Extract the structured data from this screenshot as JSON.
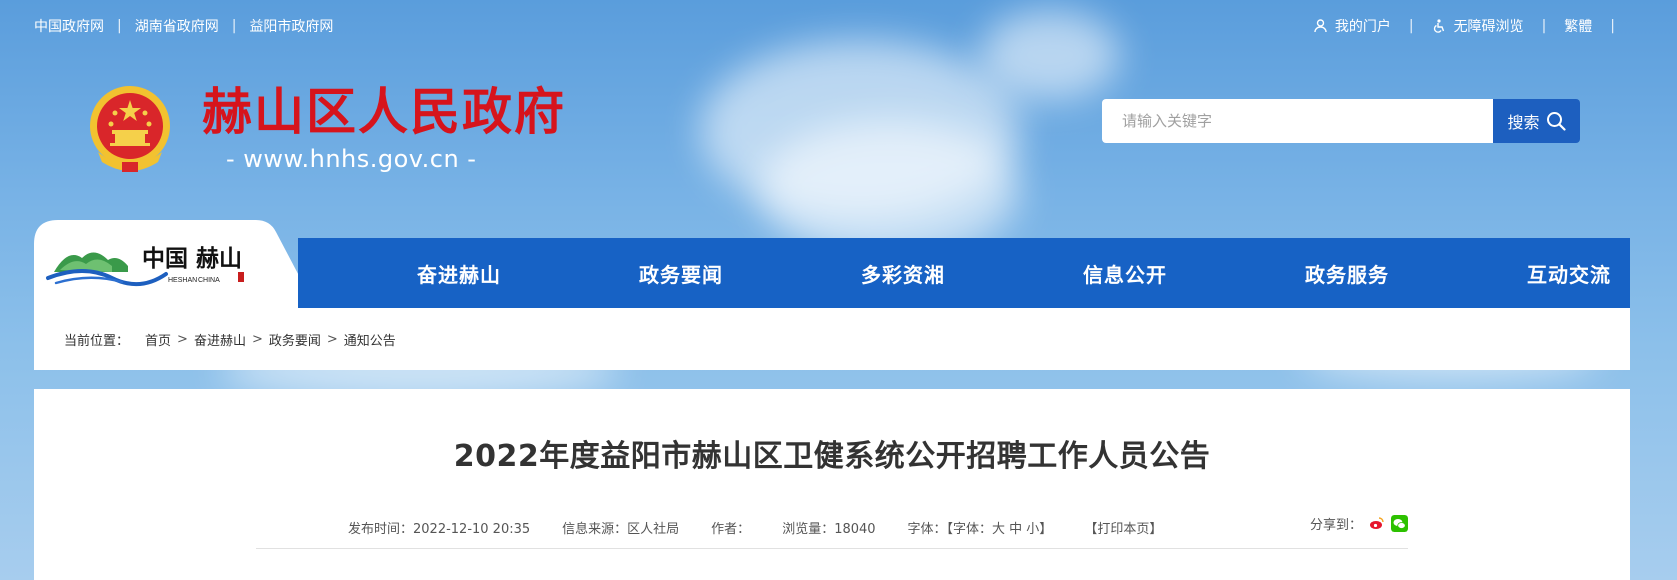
{
  "top_links": [
    "中国政府网",
    "湖南省政府网",
    "益阳市政府网"
  ],
  "top_right": {
    "portal": "我的门户",
    "accessible": "无障碍浏览",
    "traditional": "繁體"
  },
  "header": {
    "title": "赫山区人民政府",
    "url": "- www.hnhs.gov.cn -"
  },
  "search": {
    "placeholder": "请输入关键字",
    "button": "搜索"
  },
  "logo_tab": {
    "cn": "中国 赫山",
    "en_left": "HESHAN",
    "en_right": "CHINA"
  },
  "nav": [
    "奋进赫山",
    "政务要闻",
    "多彩资湘",
    "信息公开",
    "政务服务",
    "互动交流"
  ],
  "breadcrumb": {
    "label": "当前位置：",
    "items": [
      "首页",
      "奋进赫山",
      "政务要闻",
      "通知公告"
    ],
    "separator": ">"
  },
  "article": {
    "title": "2022年度益阳市赫山区卫健系统公开招聘工作人员公告",
    "publish": "发布时间：2022-12-10 20:35",
    "source": "信息来源：区人社局",
    "author": "作者：",
    "views": "浏览量：18040",
    "font": "字体：【字体：大 中 小】",
    "print": "【打印本页】",
    "share": "分享到："
  },
  "colors": {
    "nav_blue": "#1762c5",
    "title_red": "#d6141c",
    "search_btn": "#1d5fbf"
  }
}
